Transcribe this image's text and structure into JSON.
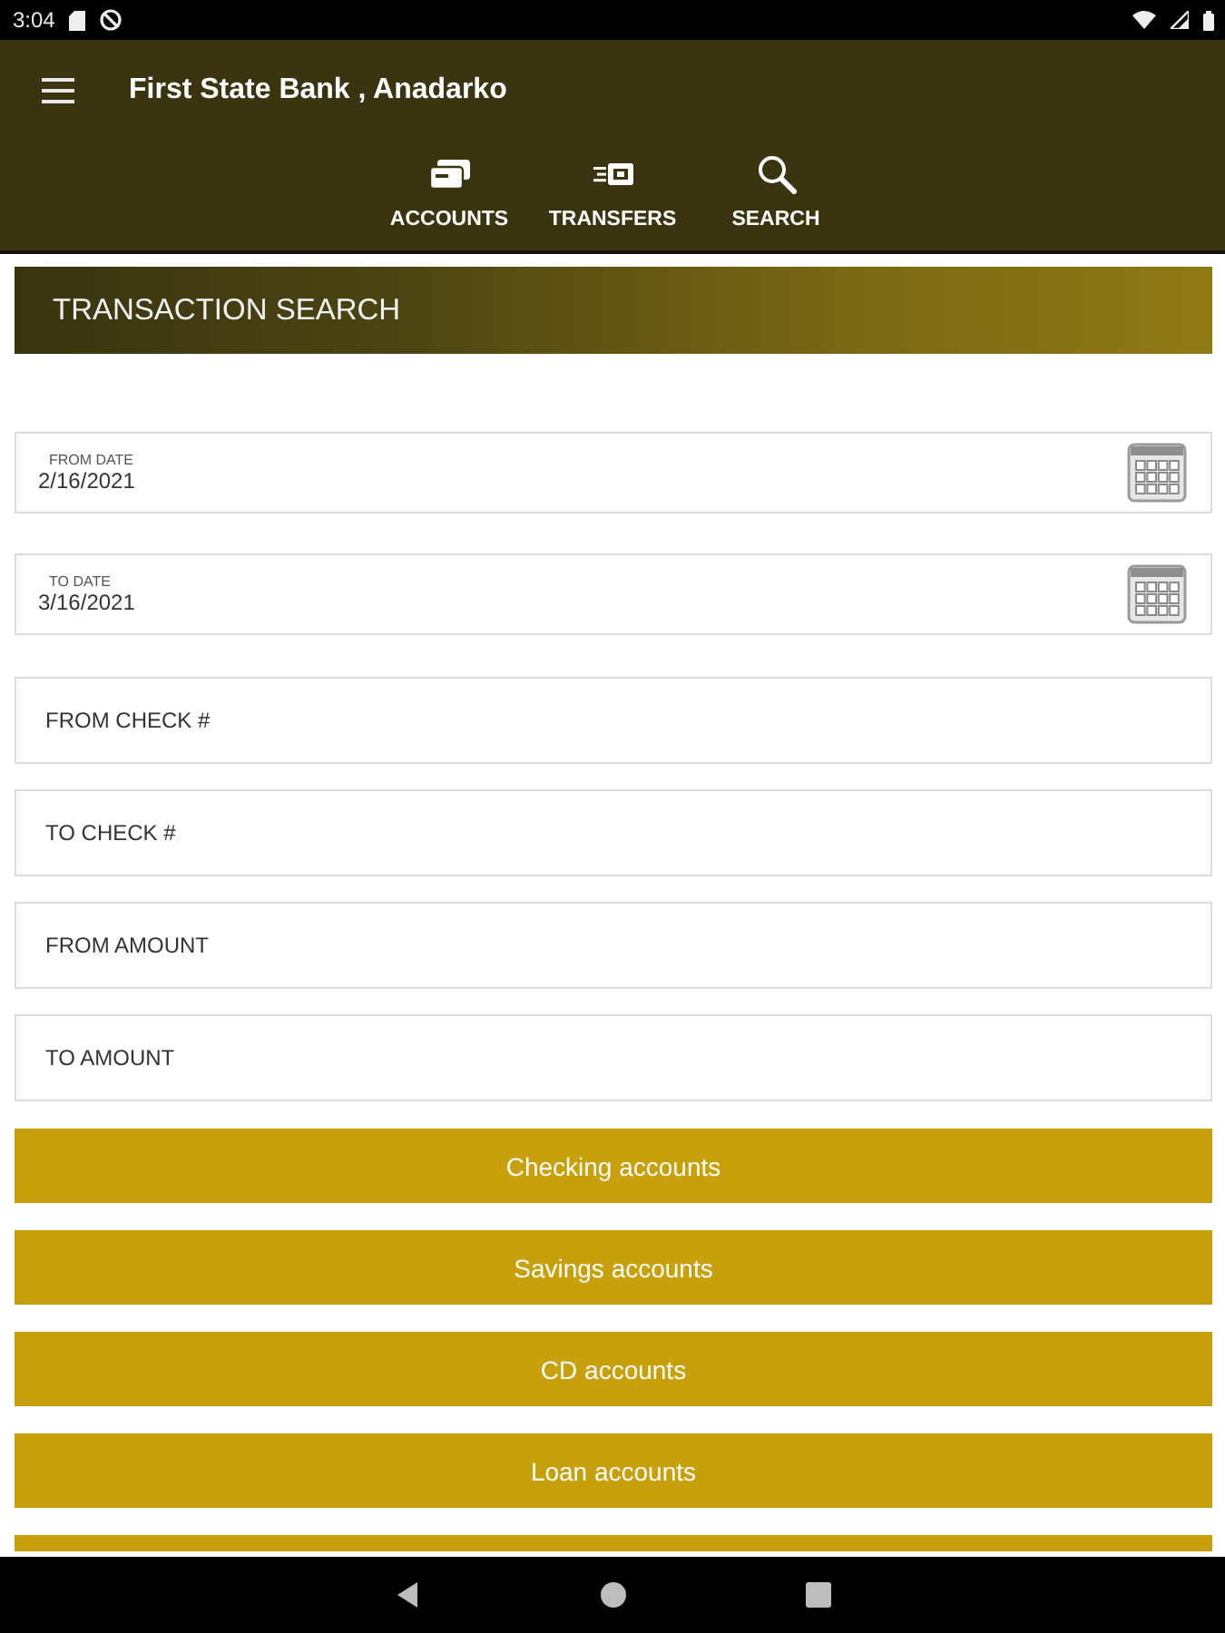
{
  "status_bar": {
    "time": "3:04"
  },
  "app_bar": {
    "title": "First State Bank , Anadarko"
  },
  "nav": [
    {
      "label": "ACCOUNTS"
    },
    {
      "label": "TRANSFERS"
    },
    {
      "label": "SEARCH"
    }
  ],
  "page_header": {
    "title": "TRANSACTION SEARCH"
  },
  "date_fields": [
    {
      "label": "FROM DATE",
      "value": "2/16/2021"
    },
    {
      "label": "TO DATE",
      "value": "3/16/2021"
    }
  ],
  "text_fields": [
    {
      "placeholder": "FROM CHECK #"
    },
    {
      "placeholder": "TO CHECK #"
    },
    {
      "placeholder": "FROM AMOUNT"
    },
    {
      "placeholder": "TO AMOUNT"
    }
  ],
  "account_buttons": [
    {
      "kind": "full",
      "label": "Checking accounts"
    },
    {
      "kind": "full",
      "label": "Savings accounts"
    },
    {
      "kind": "full",
      "label": "CD accounts"
    },
    {
      "kind": "full",
      "label": "Loan accounts"
    },
    {
      "kind": "clipped"
    }
  ]
}
